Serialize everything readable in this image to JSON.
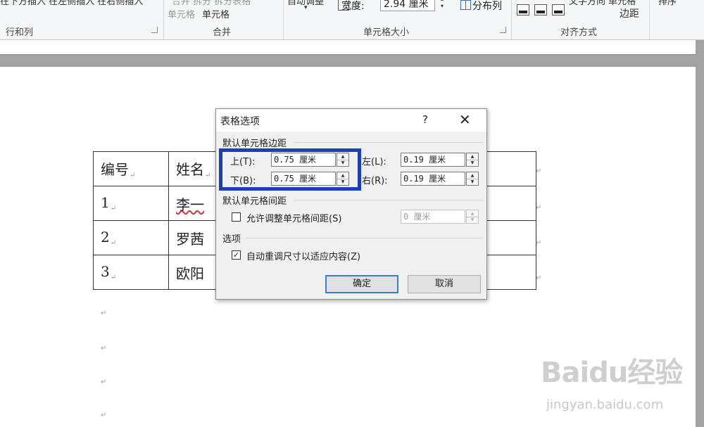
{
  "ribbon": {
    "partial_top_left": "在下方插入 在左侧插入 在右侧插入",
    "partial_merge_top": "合并   拆分   拆分表格",
    "merge_bottom_1": "单元格",
    "merge_bottom_2": "单元格",
    "autofit_label": "自动调整",
    "width_label": "宽度:",
    "width_value": "2.94 厘米",
    "distribute_col": "分布列",
    "margin_top_partial": "文字方向 单元格",
    "margin_label": "边距",
    "sort_partial": "排序",
    "groups": {
      "rows_cols": "行和列",
      "merge": "合并",
      "cell_size": "单元格大小",
      "alignment": "对齐方式"
    }
  },
  "document": {
    "table": [
      [
        "编号",
        "姓名",
        ""
      ],
      [
        "1",
        "李一",
        ""
      ],
      [
        "2",
        "罗茜",
        ""
      ],
      [
        "3",
        "欧阳",
        ""
      ]
    ],
    "cell_mark": "↵",
    "para_mark": "↵"
  },
  "dialog": {
    "title": "表格选项",
    "help": "?",
    "close": "✕",
    "section_margins": "默认单元格边距",
    "top_label": "上(T):",
    "top_value": "0.75 厘米",
    "bottom_label": "下(B):",
    "bottom_value": "0.75 厘米",
    "left_label": "左(L):",
    "left_value": "0.19 厘米",
    "right_label": "右(R):",
    "right_value": "0.19 厘米",
    "section_spacing": "默认单元格间距",
    "allow_spacing_label": "允许调整单元格间距(S)",
    "allow_spacing_checked": false,
    "spacing_value": "0 厘米",
    "section_options": "选项",
    "autoresize_label": "自动重调尺寸以适应内容(Z)",
    "autoresize_checked": true,
    "ok": "确定",
    "cancel": "取消",
    "check_mark": "✓"
  },
  "watermark": {
    "brand": "Baidu经验",
    "url": "jingyan.baidu.com"
  },
  "colors": {
    "highlight": "#1a3fb8",
    "default_button_border": "#3c7bd4"
  }
}
